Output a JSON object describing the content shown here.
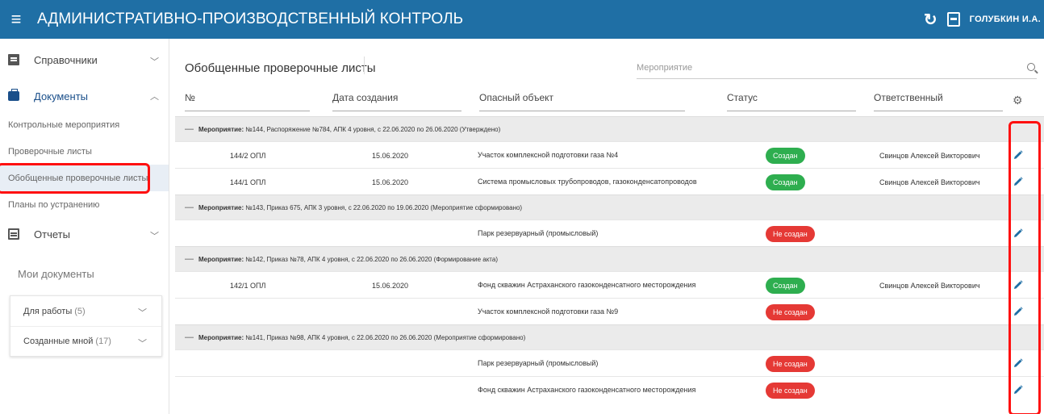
{
  "header": {
    "title": "АДМИНИСТРАТИВНО-ПРОИЗВОДСТВЕННЫЙ КОНТРОЛЬ",
    "user": "ГОЛУБКИН И.А.",
    "bg_color": "#1f6fa5"
  },
  "sidebar": {
    "items": [
      {
        "label": "Справочники",
        "icon": "document-icon"
      },
      {
        "label": "Документы",
        "icon": "briefcase-icon"
      },
      {
        "label": "Отчеты",
        "icon": "calendar-icon"
      }
    ],
    "sub_items": [
      {
        "label": "Контрольные мероприятия"
      },
      {
        "label": "Проверочные листы"
      },
      {
        "label": "Обобщенные проверочные листы"
      },
      {
        "label": "Планы по устранению"
      }
    ],
    "my_docs_label": "Мои документы",
    "my_docs": [
      {
        "label": "Для работы",
        "count": "(5)"
      },
      {
        "label": "Созданные мной",
        "count": "(17)"
      }
    ]
  },
  "main": {
    "title": "Обобщенные проверочные листы",
    "search_placeholder": "Мероприятие",
    "columns": [
      "№",
      "Дата создания",
      "Опасный объект",
      "Статус",
      "Ответственный"
    ],
    "groups": [
      {
        "prefix": "Мероприятие:",
        "text": "№144, Распоряжение №784, АПК 4 уровня, с 22.06.2020 по 26.06.2020 (Утверждено)",
        "rows": [
          {
            "num": "144/2 ОПЛ",
            "date": "15.06.2020",
            "object": "Участок комплексной подготовки газа №4",
            "status": "Создан",
            "status_type": "green",
            "resp": "Свинцов Алексей Викторович"
          },
          {
            "num": "144/1 ОПЛ",
            "date": "15.06.2020",
            "object": "Система промысловых трубопроводов, газоконденсатопроводов",
            "status": "Создан",
            "status_type": "green",
            "resp": "Свинцов Алексей Викторович"
          }
        ]
      },
      {
        "prefix": "Мероприятие:",
        "text": "№143, Приказ 675, АПК 3 уровня, с 22.06.2020 по 19.06.2020 (Мероприятие сформировано)",
        "rows": [
          {
            "num": "",
            "date": "",
            "object": "Парк резервуарный (промысловый)",
            "status": "Не создан",
            "status_type": "red",
            "resp": ""
          }
        ]
      },
      {
        "prefix": "Мероприятие:",
        "text": "№142, Приказ №78, АПК 4 уровня, с 22.06.2020 по 26.06.2020 (Формирование акта)",
        "rows": [
          {
            "num": "142/1 ОПЛ",
            "date": "15.06.2020",
            "object": "Фонд скважин Астраханского газоконденсатного месторождения",
            "status": "Создан",
            "status_type": "green",
            "resp": "Свинцов Алексей Викторович"
          },
          {
            "num": "",
            "date": "",
            "object": "Участок комплексной подготовки газа №9",
            "status": "Не создан",
            "status_type": "red",
            "resp": ""
          }
        ]
      },
      {
        "prefix": "Мероприятие:",
        "text": "№141, Приказ №98, АПК 4 уровня, с 22.06.2020 по 26.06.2020 (Мероприятие сформировано)",
        "rows": [
          {
            "num": "",
            "date": "",
            "object": "Парк резервуарный (промысловый)",
            "status": "Не создан",
            "status_type": "red",
            "resp": ""
          },
          {
            "num": "",
            "date": "",
            "object": "Фонд скважин Астраханского газоконденсатного месторождения",
            "status": "Не создан",
            "status_type": "red",
            "resp": ""
          }
        ]
      }
    ]
  }
}
